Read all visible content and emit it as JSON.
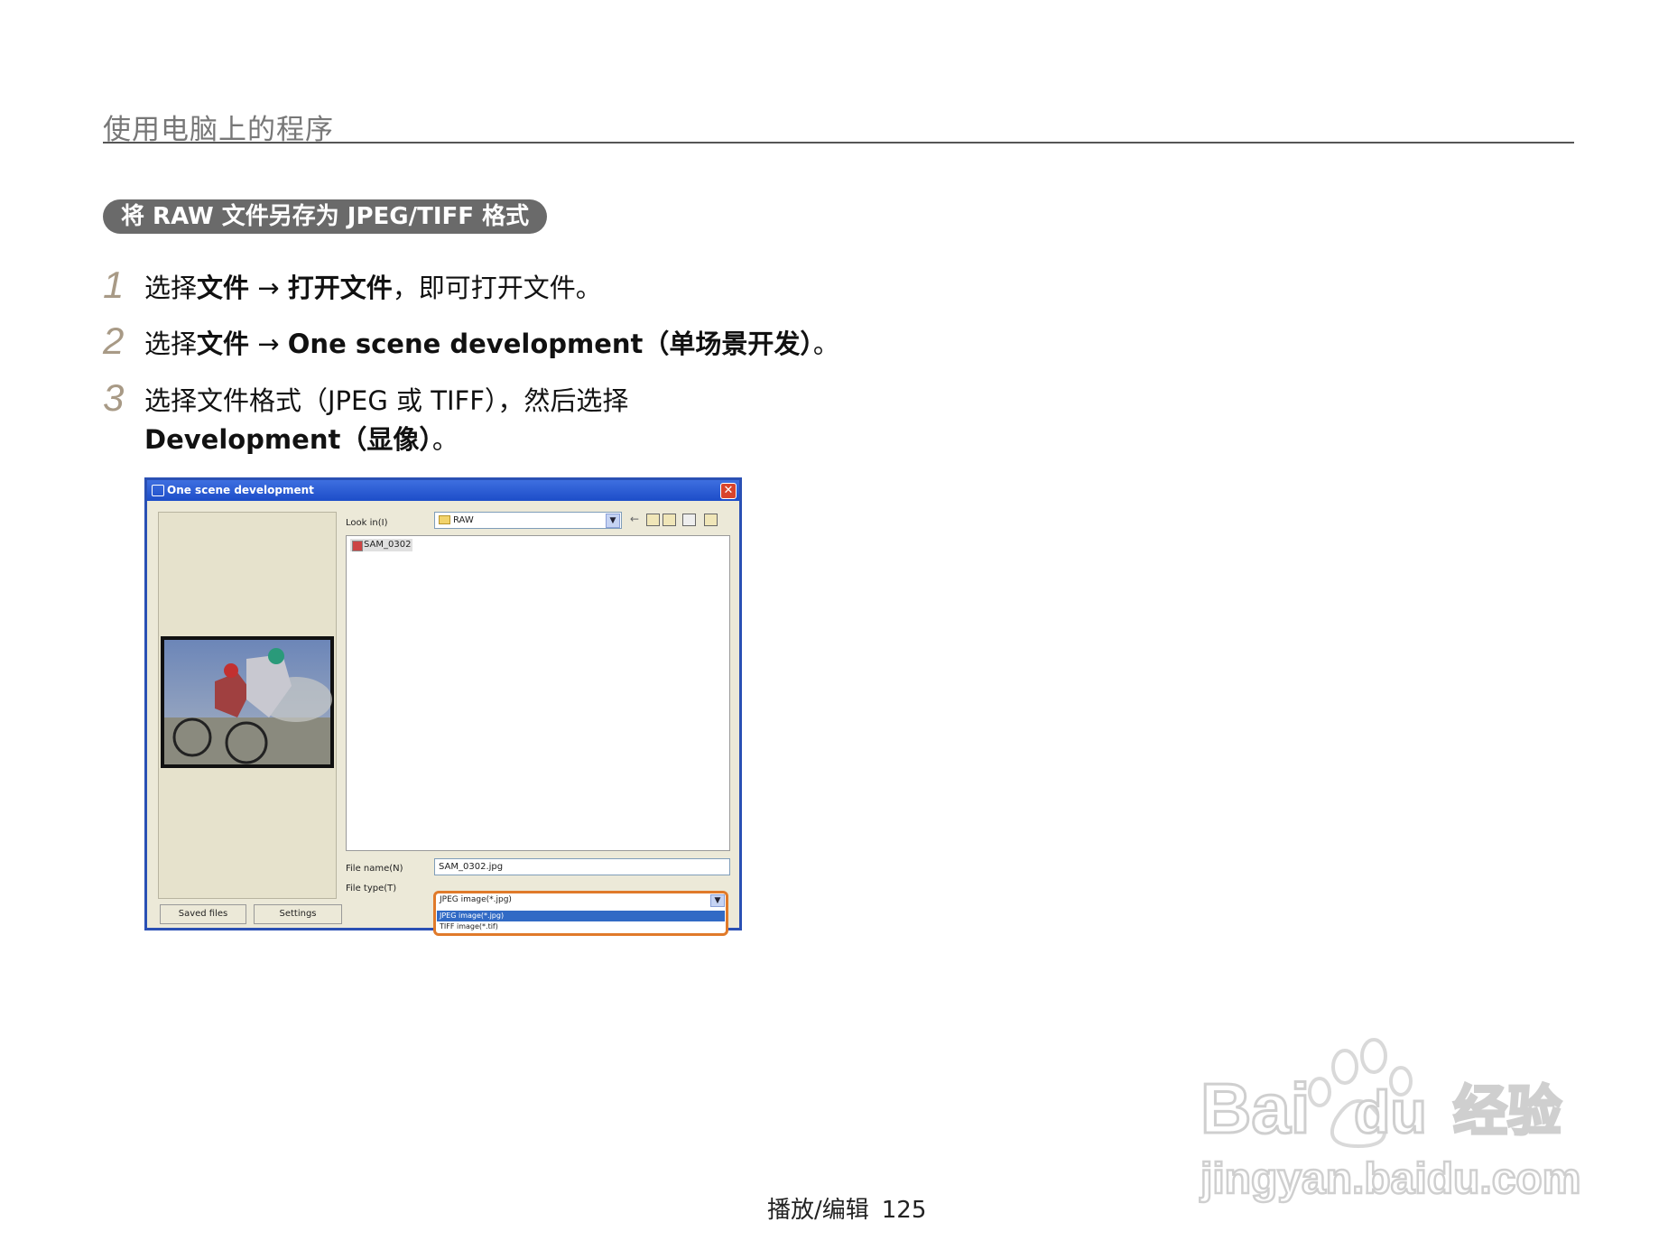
{
  "header": {
    "title": "使用电脑上的程序"
  },
  "section": {
    "title": "将 RAW 文件另存为 JPEG/TIFF 格式"
  },
  "steps": [
    {
      "num": "1",
      "a": "选择",
      "b": "文件",
      "c": " → ",
      "d": "打开文件",
      "e": "，即可打开文件。"
    },
    {
      "num": "2",
      "a": "选择",
      "b": "文件",
      "c": " → ",
      "d": "One scene development（单场景开发）",
      "e": "。"
    },
    {
      "num": "3",
      "line1": "选择文件格式（JPEG 或 TIFF），然后选择",
      "line2_bold": "Development（显像）",
      "line2_rest": "。"
    }
  ],
  "dialog": {
    "title": "One scene development",
    "look_in_label": "Look in(I)",
    "look_in_value": "RAW",
    "file_item": "SAM_0302",
    "file_name_label": "File name(N)",
    "file_name_value": "SAM_0302.jpg",
    "file_type_label": "File type(T)",
    "file_type_value": "JPEG image(*.jpg)",
    "file_type_options": [
      "JPEG image(*.jpg)",
      "TIFF image(*.tif)"
    ],
    "tabs": [
      "Saved files",
      "Settings"
    ]
  },
  "footer": {
    "section": "播放/编辑",
    "page": "125"
  },
  "watermark": {
    "brand": "Baidu",
    "cn": "经验",
    "url": "jingyan.baidu.com"
  }
}
